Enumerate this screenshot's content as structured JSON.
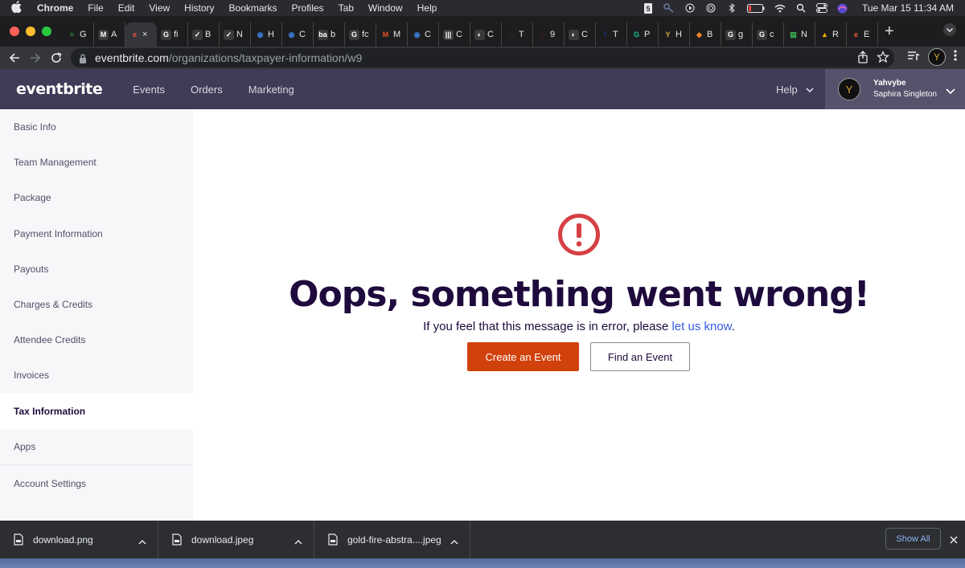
{
  "mac_menubar": {
    "app": "Chrome",
    "menus": [
      "File",
      "Edit",
      "View",
      "History",
      "Bookmarks",
      "Profiles",
      "Tab",
      "Window",
      "Help"
    ],
    "clock": "Tue Mar 15  11:34 AM"
  },
  "tabs": [
    {
      "icon": "robinhood-icon",
      "letter": "G",
      "color": "#2e9d3a",
      "glyph": "≈",
      "active": false
    },
    {
      "icon": "gmail-icon",
      "letter": "A",
      "color": "#ffffff",
      "glyph": "M",
      "active": false
    },
    {
      "icon": "eventbrite-icon",
      "letter": "×",
      "color": "#f05537",
      "glyph": "e",
      "active": true
    },
    {
      "icon": "google-icon",
      "letter": "fi",
      "color": "#ffffff",
      "glyph": "G",
      "active": false
    },
    {
      "icon": "todo-icon",
      "letter": "B",
      "color": "#ffffff",
      "glyph": "✓",
      "active": false
    },
    {
      "icon": "todo-icon",
      "letter": "N",
      "color": "#ffffff",
      "glyph": "✓",
      "active": false
    },
    {
      "icon": "planet-icon",
      "letter": "H",
      "color": "#3a7bd5",
      "glyph": "◉",
      "active": false
    },
    {
      "icon": "planet-icon",
      "letter": "C",
      "color": "#3a7bd5",
      "glyph": "◉",
      "active": false
    },
    {
      "icon": "ba-icon",
      "letter": "b",
      "color": "#ffffff",
      "glyph": "ba",
      "active": false
    },
    {
      "icon": "google-icon",
      "letter": "fc",
      "color": "#ffffff",
      "glyph": "G",
      "active": false
    },
    {
      "icon": "m-icon",
      "letter": "M",
      "color": "#e94e1b",
      "glyph": "M",
      "active": false
    },
    {
      "icon": "planet-icon",
      "letter": "C",
      "color": "#3a7bd5",
      "glyph": "◉",
      "active": false
    },
    {
      "icon": "barcode-icon",
      "letter": "C",
      "color": "#ffffff",
      "glyph": "|||",
      "active": false
    },
    {
      "icon": "globe-icon",
      "letter": "C",
      "color": "#ffffff",
      "glyph": "◐",
      "active": false
    },
    {
      "icon": "ring-icon",
      "letter": "T",
      "color": "#d1410c",
      "glyph": "◌",
      "active": false
    },
    {
      "icon": "ring-icon",
      "letter": "9",
      "color": "#d1410c",
      "glyph": "◌",
      "active": false
    },
    {
      "icon": "globe-icon",
      "letter": "C",
      "color": "#ffffff",
      "glyph": "◐",
      "active": false
    },
    {
      "icon": "t-icon",
      "letter": "T",
      "color": "#1a2b6b",
      "glyph": "T",
      "active": false
    },
    {
      "icon": "grammarly-icon",
      "letter": "P",
      "color": "#15c39a",
      "glyph": "G",
      "active": false
    },
    {
      "icon": "y-icon",
      "letter": "H",
      "color": "#d4a93a",
      "glyph": "Y",
      "active": false
    },
    {
      "icon": "brave-icon",
      "letter": "B",
      "color": "#f0842c",
      "glyph": "◆",
      "active": false
    },
    {
      "icon": "google-icon",
      "letter": "g",
      "color": "#ffffff",
      "glyph": "G",
      "active": false
    },
    {
      "icon": "google-icon",
      "letter": "c",
      "color": "#ffffff",
      "glyph": "G",
      "active": false
    },
    {
      "icon": "book-icon",
      "letter": "N",
      "color": "#3cba54",
      "glyph": "▤",
      "active": false
    },
    {
      "icon": "drive-icon",
      "letter": "R",
      "color": "#f4b400",
      "glyph": "▲",
      "active": false
    },
    {
      "icon": "eventbrite-icon",
      "letter": "E",
      "color": "#f05537",
      "glyph": "e",
      "active": false
    }
  ],
  "address": {
    "domain": "eventbrite.com",
    "path": "/organizations/taxpayer-information/w9"
  },
  "eb_header": {
    "logo": "eventbrite",
    "nav": [
      "Events",
      "Orders",
      "Marketing"
    ],
    "help": "Help",
    "user_org": "Yahvybe",
    "user_name": "Saphira Singleton"
  },
  "sidebar": {
    "items": [
      {
        "label": "Basic Info",
        "active": false
      },
      {
        "label": "Team Management",
        "active": false
      },
      {
        "label": "Package",
        "active": false
      },
      {
        "label": "Payment Information",
        "active": false
      },
      {
        "label": "Payouts",
        "active": false
      },
      {
        "label": "Charges & Credits",
        "active": false
      },
      {
        "label": "Attendee Credits",
        "active": false
      },
      {
        "label": "Invoices",
        "active": false
      },
      {
        "label": "Tax Information",
        "active": true
      },
      {
        "label": "Apps",
        "active": false
      },
      {
        "label": "Account Settings",
        "active": false
      }
    ]
  },
  "error": {
    "title": "Oops, something went wrong!",
    "message_prefix": "If you feel that this message is in error, please ",
    "message_link": "let us know",
    "message_suffix": ".",
    "primary_button": "Create an Event",
    "secondary_button": "Find an Event",
    "icon_color": "#d64045"
  },
  "downloads": {
    "items": [
      "download.png",
      "download.jpeg",
      "gold-fire-abstra....jpeg"
    ],
    "show_all": "Show All"
  },
  "colors": {
    "brand_header": "#3e3c56",
    "primary_orange": "#d1410c",
    "link_blue": "#3659e3",
    "heading_navy": "#1e0a3c"
  }
}
